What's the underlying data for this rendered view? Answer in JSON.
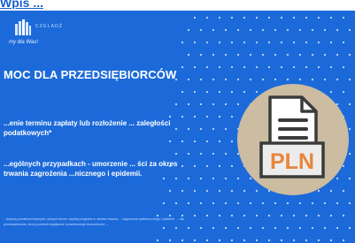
{
  "link": {
    "text": "Wpis ..."
  },
  "banner": {
    "logo": {
      "text": "CZELADŹ",
      "tagline": "my dla Was!"
    },
    "headline": "MOC DLA PRZEDSIĘBIORCÓW",
    "paragraph1": "...enie terminu zapłaty lub rozłożenie ... zaległości podatkowych*",
    "paragraph2": "...ególnych przypadkach - umorzenie ... ści za okres trwania zagrożenia ...nicznego i epidemii.",
    "footnote": "...dotyczy podatków lokalnych, których termin zapłaty przypada w okresie trwania ... zagrożenia epidemicznego i epidemii. ... dla przedsiębiorców, którzy ponieśli negatywne konsekwencje ekonomiczne ...",
    "icon_label": "PLN"
  },
  "colors": {
    "banner_bg": "#1c6ad9",
    "badge_bg": "#cbbca2",
    "icon_label": "#e8853b",
    "link": "#1a5fd0"
  }
}
